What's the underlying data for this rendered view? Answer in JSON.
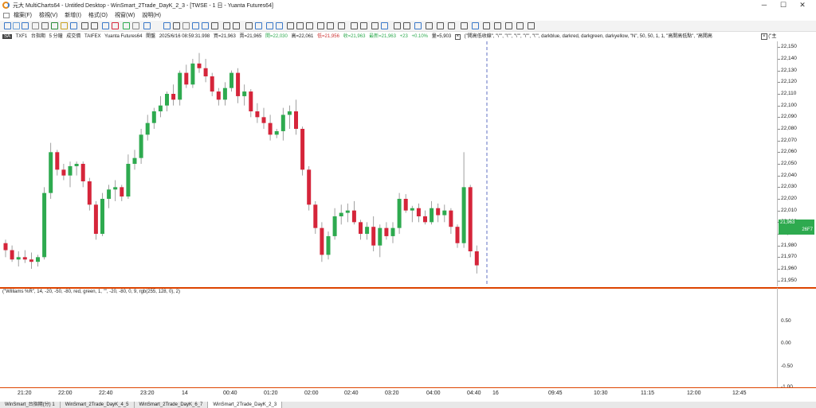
{
  "titlebar": {
    "title": "元大 MultiCharts64 - Untitled Desktop - WinSmart_2Trade_DayK_2_3 - [TWSE - 1 日 - Yuanta Futures64]",
    "minimize": "─",
    "maximize": "☐",
    "close": "✕"
  },
  "menu": [
    "檔案(F)",
    "檢視(V)",
    "新增(I)",
    "格式(O)",
    "視窗(W)",
    "說明(H)"
  ],
  "menu_help": "? ▾",
  "status": {
    "label": "SA",
    "symbol": "TXF1",
    "sym_name": "台指期",
    "interval": "5 分鐘",
    "type": "成交價",
    "exchange": "TAIFEX",
    "feed": "Yuanta Futures64",
    "section": "開盤",
    "datetime": "2025/6/16   08:59:31.998",
    "bid": "買=21,963",
    "ask": "賣=21,965",
    "open": "開=22,030",
    "high": "高=22,061",
    "low": "低=21,956",
    "close": "收=21,963",
    "last": "最新=21,963",
    "change": "+23",
    "pct": "+0.10%",
    "vol": "量=5,903",
    "study": "(\"開高低收線\", \"\\\"\", \"\\\"\", \"\\\"\", \"\\\"\", \"\\\"\", darkblue, darkred, darkgreen, darkyellow, \"N\", 50, 50, 1, 1, \"高開高低點\", \"高開高",
    "right_tag": "(\"主"
  },
  "colors": {
    "up": "#2eaa4f",
    "down": "#d5253a",
    "divider": "#dd4400",
    "cursor": "#3a4fb5"
  },
  "price_axis": {
    "ticks": [
      "22,150",
      "22,140",
      "22,130",
      "22,120",
      "22,110",
      "22,100",
      "22,090",
      "22,080",
      "22,070",
      "22,060",
      "22,050",
      "22,040",
      "22,030",
      "22,020",
      "22,010",
      "22,000",
      "21,990",
      "21,980",
      "21,970",
      "21,960",
      "21,950"
    ],
    "last_price": "21,963",
    "last_tag": "26F7"
  },
  "subchart": {
    "title": "(\"Williams %R\", 14, -20, -50, -80, red, green, 1, \"\", -20, -80, 0, 9, rgb(255, 128, 0), 2)",
    "ticks": [
      "0.50",
      "0.00",
      "-0.50",
      "-1.00"
    ]
  },
  "time_axis": [
    "21:20",
    "22:00",
    "22:40",
    "23:20",
    "14",
    "00:40",
    "01:20",
    "02:00",
    "02:40",
    "03:20",
    "04:00",
    "04:40",
    "16",
    "09:45",
    "10:30",
    "11:15",
    "12:00",
    "12:45"
  ],
  "tabs": [
    "WinSmart_台指期(分) 1",
    "WinSmart_2Trade_DayK_4_5",
    "WinSmart_2Trade_DayK_6_7",
    "WinSmart_2Trade_DayK_2_3"
  ],
  "chart_data": {
    "type": "candlestick",
    "ylim": [
      21945,
      22155
    ],
    "candles": [
      [
        21982,
        21985,
        21970,
        21976
      ],
      [
        21976,
        21980,
        21966,
        21968
      ],
      [
        21968,
        21975,
        21962,
        21970
      ],
      [
        21970,
        21976,
        21965,
        21968
      ],
      [
        21968,
        21974,
        21960,
        21966
      ],
      [
        21966,
        21972,
        21962,
        21970
      ],
      [
        21970,
        22030,
        21968,
        22025
      ],
      [
        22025,
        22068,
        22020,
        22060
      ],
      [
        22060,
        22062,
        22040,
        22045
      ],
      [
        22045,
        22050,
        22036,
        22040
      ],
      [
        22040,
        22052,
        22030,
        22048
      ],
      [
        22048,
        22052,
        22040,
        22050
      ],
      [
        22050,
        22052,
        22030,
        22035
      ],
      [
        22035,
        22038,
        22010,
        22015
      ],
      [
        22015,
        22018,
        21985,
        21990
      ],
      [
        21990,
        22025,
        21988,
        22020
      ],
      [
        22020,
        22032,
        22012,
        22028
      ],
      [
        22028,
        22036,
        22018,
        22030
      ],
      [
        22030,
        22032,
        22018,
        22022
      ],
      [
        22022,
        22058,
        22020,
        22050
      ],
      [
        22050,
        22062,
        22045,
        22055
      ],
      [
        22055,
        22080,
        22050,
        22075
      ],
      [
        22075,
        22092,
        22070,
        22085
      ],
      [
        22085,
        22098,
        22080,
        22095
      ],
      [
        22095,
        22108,
        22090,
        22100
      ],
      [
        22100,
        22112,
        22095,
        22110
      ],
      [
        22110,
        22118,
        22100,
        22105
      ],
      [
        22105,
        22130,
        22100,
        22128
      ],
      [
        22128,
        22135,
        22115,
        22118
      ],
      [
        22118,
        22140,
        22115,
        22136
      ],
      [
        22136,
        22145,
        22128,
        22132
      ],
      [
        22132,
        22140,
        22120,
        22125
      ],
      [
        22125,
        22128,
        22108,
        22112
      ],
      [
        22112,
        22115,
        22100,
        22105
      ],
      [
        22105,
        22120,
        22100,
        22115
      ],
      [
        22115,
        22130,
        22112,
        22128
      ],
      [
        22128,
        22132,
        22102,
        22108
      ],
      [
        22108,
        22118,
        22100,
        22112
      ],
      [
        22112,
        22114,
        22090,
        22095
      ],
      [
        22095,
        22102,
        22085,
        22090
      ],
      [
        22090,
        22098,
        22080,
        22085
      ],
      [
        22085,
        22092,
        22070,
        22075
      ],
      [
        22075,
        22080,
        22072,
        22078
      ],
      [
        22078,
        22098,
        22070,
        22092
      ],
      [
        22092,
        22100,
        22080,
        22095
      ],
      [
        22095,
        22105,
        22075,
        22080
      ],
      [
        22080,
        22082,
        22040,
        22045
      ],
      [
        22045,
        22048,
        22010,
        22015
      ],
      [
        22015,
        22018,
        21990,
        21995
      ],
      [
        21995,
        22000,
        21966,
        21972
      ],
      [
        21972,
        21992,
        21968,
        21988
      ],
      [
        21988,
        22012,
        21985,
        22005
      ],
      [
        22005,
        22015,
        21998,
        22008
      ],
      [
        22008,
        22016,
        22000,
        22010
      ],
      [
        22010,
        22018,
        21998,
        22000
      ],
      [
        22000,
        22002,
        21985,
        21990
      ],
      [
        21990,
        22000,
        21985,
        21996
      ],
      [
        21996,
        22005,
        21975,
        21980
      ],
      [
        21980,
        21998,
        21970,
        21995
      ],
      [
        21995,
        22000,
        21985,
        21988
      ],
      [
        21988,
        22000,
        21982,
        21995
      ],
      [
        21995,
        22025,
        21990,
        22020
      ],
      [
        22020,
        22024,
        22008,
        22010
      ],
      [
        22010,
        22014,
        22000,
        22012
      ],
      [
        22012,
        22016,
        22000,
        22005
      ],
      [
        22005,
        22010,
        21998,
        22000
      ],
      [
        22000,
        22018,
        21998,
        22012
      ],
      [
        22012,
        22016,
        22000,
        22006
      ],
      [
        22006,
        22015,
        22000,
        22010
      ],
      [
        22010,
        22012,
        21990,
        21996
      ],
      [
        21996,
        21998,
        21978,
        21982
      ],
      [
        21982,
        22060,
        21978,
        22030
      ],
      [
        22030,
        22032,
        21970,
        21975
      ],
      [
        21975,
        21980,
        21956,
        21963
      ]
    ]
  }
}
